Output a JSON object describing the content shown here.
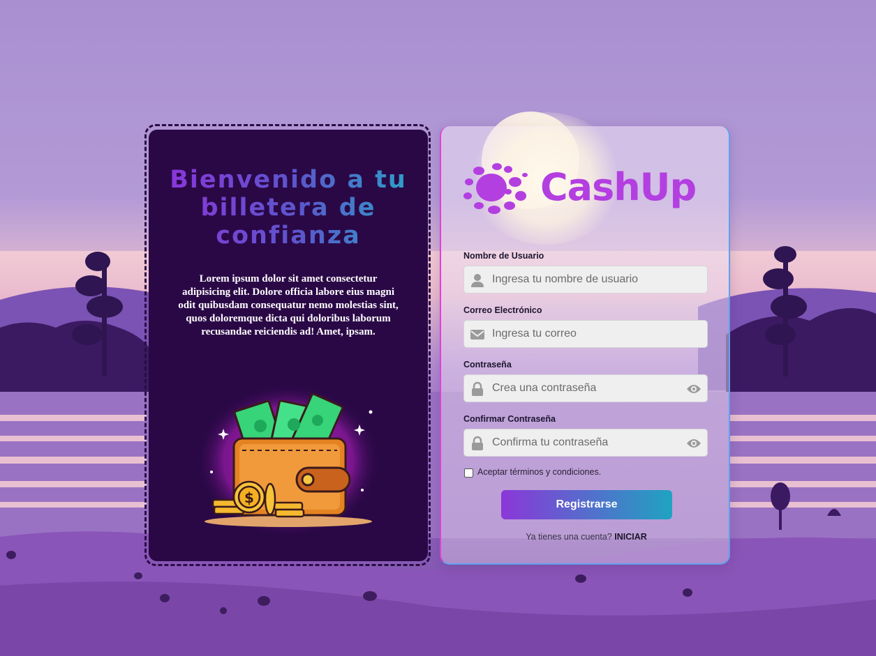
{
  "welcome": {
    "title": "Bienvenido a tu billetera de confianza",
    "text": "Lorem ipsum dolor sit amet consectetur adipisicing elit. Dolore officia labore eius magni odit quibusdam consequatur nemo molestias sint, quos doloremque dicta qui doloribus laborum recusandae reiciendis ad! Amet, ipsam."
  },
  "brand": {
    "name": "CashUp",
    "color": "#b33fe0"
  },
  "form": {
    "username": {
      "label": "Nombre de Usuario",
      "placeholder": "Ingresa tu nombre de usuario",
      "icon": "user-icon"
    },
    "email": {
      "label": "Correo Electrónico",
      "placeholder": "Ingresa tu correo",
      "icon": "envelope-icon"
    },
    "password": {
      "label": "Contraseña",
      "placeholder": "Crea una contraseña",
      "icon": "lock-icon"
    },
    "confirm": {
      "label": "Confirmar Contraseña",
      "placeholder": "Confirma tu contraseña",
      "icon": "lock-icon"
    },
    "terms": "Aceptar términos y condiciones.",
    "submit": "Registrarse",
    "has_account": "Ya tienes una cuenta?",
    "login_link": "INICIAR"
  },
  "colors": {
    "panel_bg": "#2a0846",
    "button_gradient": [
      "#8b37d8",
      "#1fa3c1"
    ],
    "title_gradient": [
      "#8a36da",
      "#2e9ec8"
    ]
  }
}
